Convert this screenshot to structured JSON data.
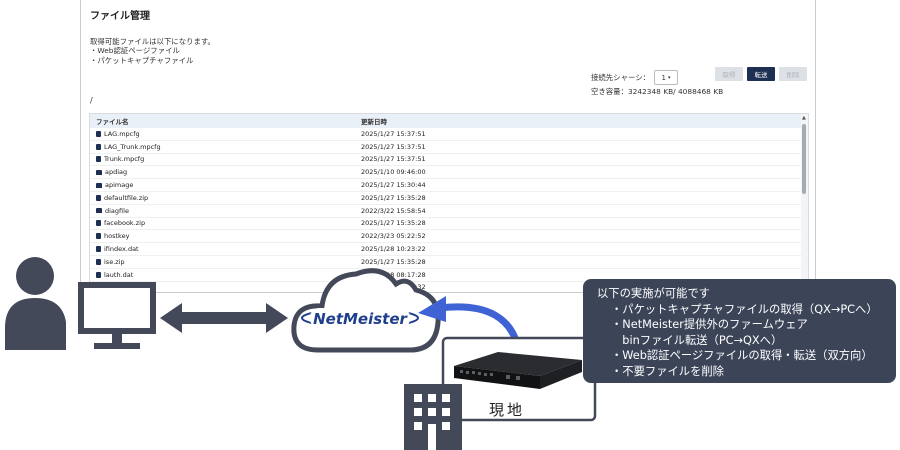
{
  "panel": {
    "title": "ファイル管理",
    "intro": [
      "取得可能ファイルは以下になります。",
      "・Web認証ページファイル",
      "・パケットキャプチャファイル"
    ],
    "chassis_label": "接続先シャーシ：",
    "chassis_value": "1",
    "capacity": "空き容量：3242348 KB/ 4088468 KB",
    "buttons": {
      "get": "取得",
      "transfer": "転送",
      "delete": "削除"
    },
    "path": "/",
    "columns": {
      "name": "ファイル名",
      "date": "更新日時"
    },
    "rows": [
      {
        "name": "LAG.mpcfg",
        "date": "2025/1/27 15:37:51",
        "type": "file"
      },
      {
        "name": "LAG_Trunk.mpcfg",
        "date": "2025/1/27 15:37:51",
        "type": "file"
      },
      {
        "name": "Trunk.mpcfg",
        "date": "2025/1/27 15:37:51",
        "type": "file"
      },
      {
        "name": "apdiag",
        "date": "2025/1/10 09:46:00",
        "type": "folder"
      },
      {
        "name": "apimage",
        "date": "2025/1/27 15:30:44",
        "type": "folder"
      },
      {
        "name": "defaultfile.zip",
        "date": "2025/1/27 15:35:28",
        "type": "file"
      },
      {
        "name": "diagfile",
        "date": "2022/3/22 15:58:54",
        "type": "folder"
      },
      {
        "name": "facebook.zip",
        "date": "2025/1/27 15:35:28",
        "type": "file"
      },
      {
        "name": "hostkey",
        "date": "2022/3/23 05:22:52",
        "type": "file"
      },
      {
        "name": "ifindex.dat",
        "date": "2025/1/28 10:23:22",
        "type": "file"
      },
      {
        "name": "ise.zip",
        "date": "2025/1/27 15:35:28",
        "type": "file"
      },
      {
        "name": "lauth.dat",
        "date": "2025/1/28 08:17:28",
        "type": "file"
      },
      {
        "name": "",
        "date": "2025/1/27 15:59:32",
        "type": "file"
      }
    ]
  },
  "diagram": {
    "logo_text": "NetMeister",
    "site_label": "現地",
    "callout": {
      "title": "以下の実施が可能です",
      "items": [
        "・パケットキャプチャファイルの取得（QX→PCへ）",
        "・NetMeister提供外のファームウェア",
        "　binファイル転送（PC→QXへ）",
        "・Web認証ページファイルの取得・転送（双方向）",
        "・不要ファイルを削除"
      ]
    },
    "colors": {
      "icon": "#44495a",
      "arrow": "#3f63d4",
      "callout_bg": "#3c4558",
      "logo": "#1f3e8c"
    }
  }
}
